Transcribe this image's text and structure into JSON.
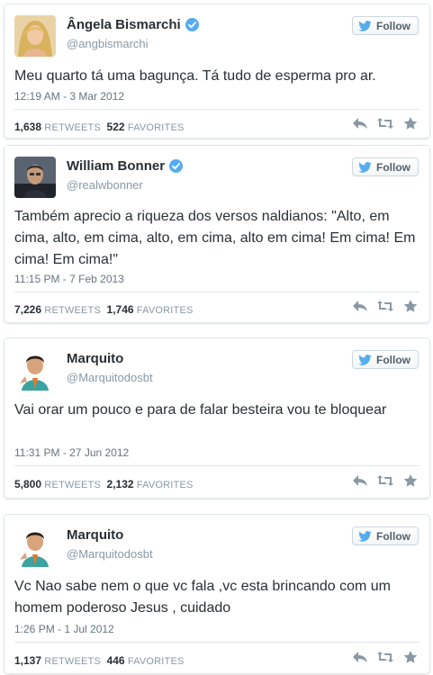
{
  "colors": {
    "link_blue": "#55acee",
    "verified_blue": "#55acee",
    "muted_text": "#8899a6",
    "icon_grey": "#8899a6"
  },
  "tweets": [
    {
      "name": "Ângela Bismarchi",
      "verified": true,
      "handle": "@angbismarchi",
      "follow_label": "Follow",
      "text": "Meu quarto tá uma bagunça. Tá tudo de esperma pro ar.",
      "date": "12:19 AM - 3 Mar 2012",
      "retweets": "1,638",
      "retweets_label": "RETWEETS",
      "favorites": "522",
      "favorites_label": "FAVORITES"
    },
    {
      "name": "William Bonner",
      "verified": true,
      "handle": "@realwbonner",
      "follow_label": "Follow",
      "text": "Também aprecio a riqueza dos versos naldianos: \"Alto, em cima, alto, em cima, alto, em cima, alto em cima! Em cima! Em cima! Em cima!\"",
      "date": "11:15 PM - 7 Feb 2013",
      "retweets": "7,226",
      "retweets_label": "RETWEETS",
      "favorites": "1,746",
      "favorites_label": "FAVORITES"
    },
    {
      "name": "Marquito",
      "verified": false,
      "handle": "@Marquitodosbt",
      "follow_label": "Follow",
      "text": "Vai orar um pouco e para de falar besteira vou te bloquear",
      "date": "11:31 PM - 27 Jun 2012",
      "retweets": "5,800",
      "retweets_label": "RETWEETS",
      "favorites": "2,132",
      "favorites_label": "FAVORITES"
    },
    {
      "name": "Marquito",
      "verified": false,
      "handle": "@Marquitodosbt",
      "follow_label": "Follow",
      "text": "Vc Nao sabe nem o que vc fala ,vc esta brincando com um homem poderoso Jesus , cuidado",
      "date": "1:26 PM - 1 Jul 2012",
      "retweets": "1,137",
      "retweets_label": "RETWEETS",
      "favorites": "446",
      "favorites_label": "FAVORITES"
    }
  ]
}
